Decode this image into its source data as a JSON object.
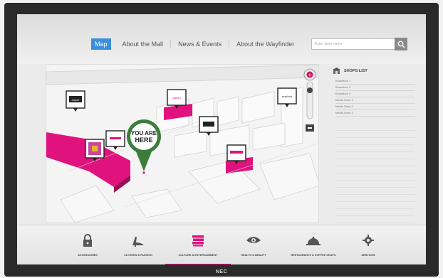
{
  "brand": "NEC",
  "nav": {
    "items": [
      {
        "label": "Map",
        "active": true
      },
      {
        "label": "About the Mall",
        "active": false
      },
      {
        "label": "News & Events",
        "active": false
      },
      {
        "label": "About the Wayfinder",
        "active": false
      }
    ],
    "search_placeholder": "Enter store name"
  },
  "map": {
    "you_are_here": [
      "YOU ARE",
      "HERE"
    ],
    "store_tags": [
      "ample",
      "claire's",
      "mankind",
      "logo",
      "store",
      "brand"
    ]
  },
  "shops": {
    "title": "SHOPS LIST",
    "items": [
      "Bookstore 1",
      "Bookstore 2",
      "Bookstore 3",
      "Media Store 1",
      "Media Store 2",
      "Media Store 3"
    ]
  },
  "categories": [
    {
      "label": "ACCESSORIES",
      "icon": "lock-icon",
      "active": false
    },
    {
      "label": "CLOTHES & FASHION",
      "icon": "high-heel-icon",
      "active": false
    },
    {
      "label": "CULTURE & ENTERTAINMENT",
      "icon": "books-icon",
      "active": true
    },
    {
      "label": "HEALTH & BEAUTY",
      "icon": "eye-icon",
      "active": false
    },
    {
      "label": "RESTAURANTS & COFFEE SHOPS",
      "icon": "cloche-icon",
      "active": false
    },
    {
      "label": "SERVICES",
      "icon": "gear-icon",
      "active": false
    }
  ],
  "colors": {
    "accent": "#e0127e",
    "nav_active": "#3b8fdc",
    "marker_green": "#3c7d3c"
  }
}
